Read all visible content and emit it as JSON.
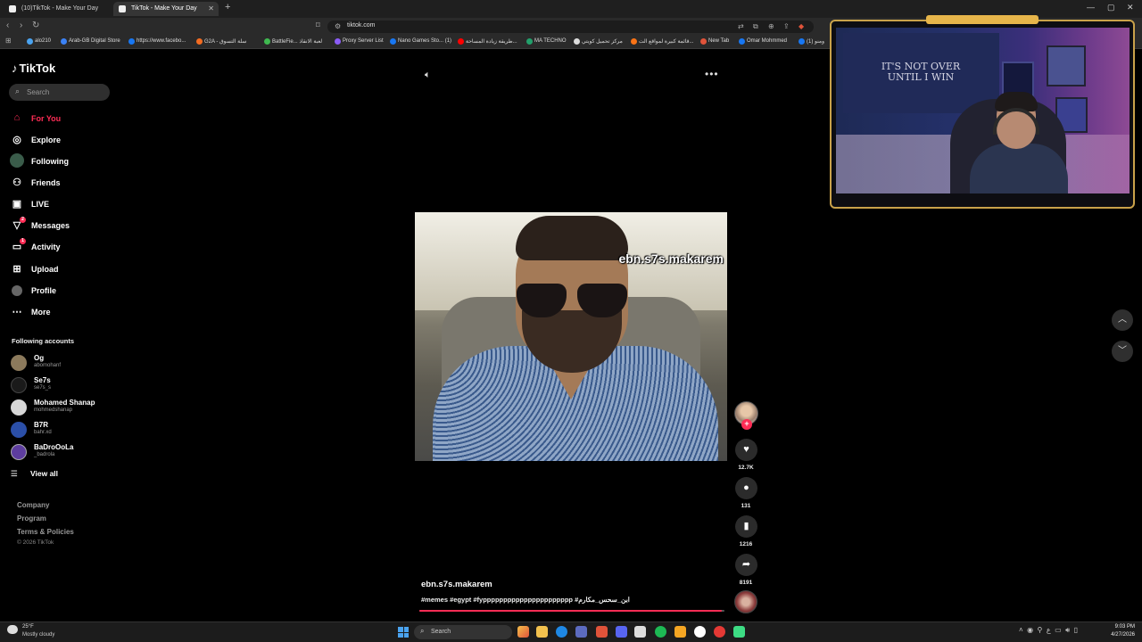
{
  "browser": {
    "tabs": [
      {
        "label": "(10)TikTok - Make Your Day",
        "active": false
      },
      {
        "label": "TikTok - Make Your Day",
        "active": true
      }
    ],
    "url": "tiktok.com",
    "bookmarks": [
      "alo210",
      "Arab-GB Digital Store",
      "https://www.facebo...",
      "G2A - سلة التسوق",
      "BattleFie... لعبة الانقاذ",
      "Proxy Server List",
      "Nano Games Sto... (1)",
      "طريقة زيادة المساحة...",
      "MA TECHNO",
      "مركز تحميل كويتي",
      "قائمة كبيرة لمواقع الت...",
      "New Tab",
      "Omar Mohmmed",
      "(1) ومنو"
    ]
  },
  "sidebar": {
    "brand": "TikTok",
    "search_placeholder": "Search",
    "nav": [
      {
        "label": "For You",
        "icon": "home-icon",
        "active": true
      },
      {
        "label": "Explore",
        "icon": "compass-icon"
      },
      {
        "label": "Following",
        "icon": "following-avatar-icon"
      },
      {
        "label": "Friends",
        "icon": "friends-icon"
      },
      {
        "label": "LIVE",
        "icon": "live-icon"
      },
      {
        "label": "Messages",
        "icon": "messages-icon",
        "badge": "2"
      },
      {
        "label": "Activity",
        "icon": "activity-icon",
        "badge": "1"
      },
      {
        "label": "Upload",
        "icon": "upload-icon"
      },
      {
        "label": "Profile",
        "icon": "profile-icon"
      },
      {
        "label": "More",
        "icon": "more-icon"
      }
    ],
    "following_heading": "Following accounts",
    "accounts": [
      {
        "name": "Og",
        "handle": "abomohanf"
      },
      {
        "name": "Se7s",
        "handle": "se7s_s"
      },
      {
        "name": "Mohamed Shanap",
        "handle": "mohmedshanap"
      },
      {
        "name": "B7R",
        "handle": "bahr.xd"
      },
      {
        "name": "BaDroOoLa",
        "handle": "_badrola"
      }
    ],
    "view_all": "View all",
    "footer": [
      "Company",
      "Program",
      "Terms & Policies"
    ],
    "copyright": "© 2026 TikTok"
  },
  "video": {
    "watermark": "ebn.s7s.makarem",
    "username": "ebn.s7s.makarem",
    "caption": "#memes #egypt #fypppppppppppppppppppppp #ابن_سحس_مكارم",
    "progress": 0.99,
    "likes": "12.7K",
    "comments": "131",
    "saves": "1216",
    "shares": "8191"
  },
  "webcam": {
    "banner_text": "IT'S NOT OVER UNTIL I WIN"
  },
  "taskbar": {
    "temperature": "25°F",
    "weather": "Mostly cloudy",
    "search_label": "Search",
    "time": "9:03 PM",
    "date": "4/27/2026"
  }
}
